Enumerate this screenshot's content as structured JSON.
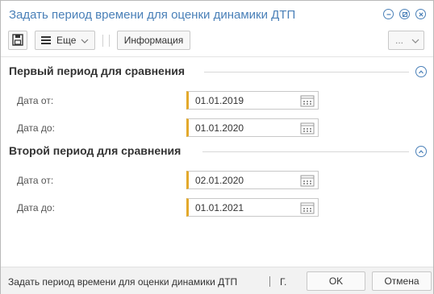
{
  "window": {
    "title": "Задать период времени для оценки динамики ДТП",
    "controls": [
      "minimize-icon",
      "link-icon",
      "close-icon"
    ]
  },
  "toolbar": {
    "save_icon": "save-icon",
    "more_label": "Еще",
    "info_label": "Информация",
    "overflow_label": "..."
  },
  "sections": [
    {
      "title": "Первый период для сравнения",
      "fields": [
        {
          "label": "Дата от:",
          "value": "01.01.2019"
        },
        {
          "label": "Дата до:",
          "value": "01.01.2020"
        }
      ]
    },
    {
      "title": "Второй период для сравнения",
      "fields": [
        {
          "label": "Дата от:",
          "value": "02.01.2020"
        },
        {
          "label": "Дата до:",
          "value": "01.01.2021"
        }
      ]
    }
  ],
  "footer": {
    "status": "Задать период времени для оценки динамики ДТП",
    "suffix": "Г.",
    "ok_label": "OK",
    "cancel_label": "Отмена"
  },
  "colors": {
    "accent": "#4a80b8",
    "required_marker": "#e3a92b"
  }
}
